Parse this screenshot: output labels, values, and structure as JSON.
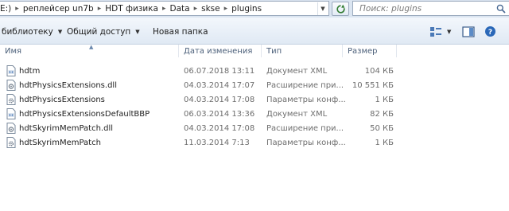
{
  "address": {
    "crumbs": [
      "E:)",
      "реплейсер un7b",
      "HDT физика",
      "Data",
      "skse",
      "plugins"
    ]
  },
  "search": {
    "placeholder": "Поиск: plugins"
  },
  "toolbar": {
    "library_label": "библиотеку",
    "share_label": "Общий доступ",
    "new_folder_label": "Новая папка"
  },
  "columns": {
    "name": "Имя",
    "date": "Дата изменения",
    "type": "Тип",
    "size": "Размер"
  },
  "files": [
    {
      "name": "hdtm",
      "date": "06.07.2018 13:11",
      "type": "Документ XML",
      "size": "104 КБ",
      "icon": "xml-file-icon"
    },
    {
      "name": "hdtPhysicsExtensions.dll",
      "date": "04.03.2014 17:07",
      "type": "Расширение при...",
      "size": "10 551 КБ",
      "icon": "dll-file-icon"
    },
    {
      "name": "hdtPhysicsExtensions",
      "date": "04.03.2014 17:08",
      "type": "Параметры конф...",
      "size": "1 КБ",
      "icon": "config-file-icon"
    },
    {
      "name": "hdtPhysicsExtensionsDefaultBBP",
      "date": "06.03.2014 13:36",
      "type": "Документ XML",
      "size": "82 КБ",
      "icon": "xml-file-icon"
    },
    {
      "name": "hdtSkyrimMemPatch.dll",
      "date": "04.03.2014 17:08",
      "type": "Расширение при...",
      "size": "50 КБ",
      "icon": "dll-file-icon"
    },
    {
      "name": "hdtSkyrimMemPatch",
      "date": "11.03.2014 7:13",
      "type": "Параметры конф...",
      "size": "1 КБ",
      "icon": "config-file-icon"
    }
  ]
}
